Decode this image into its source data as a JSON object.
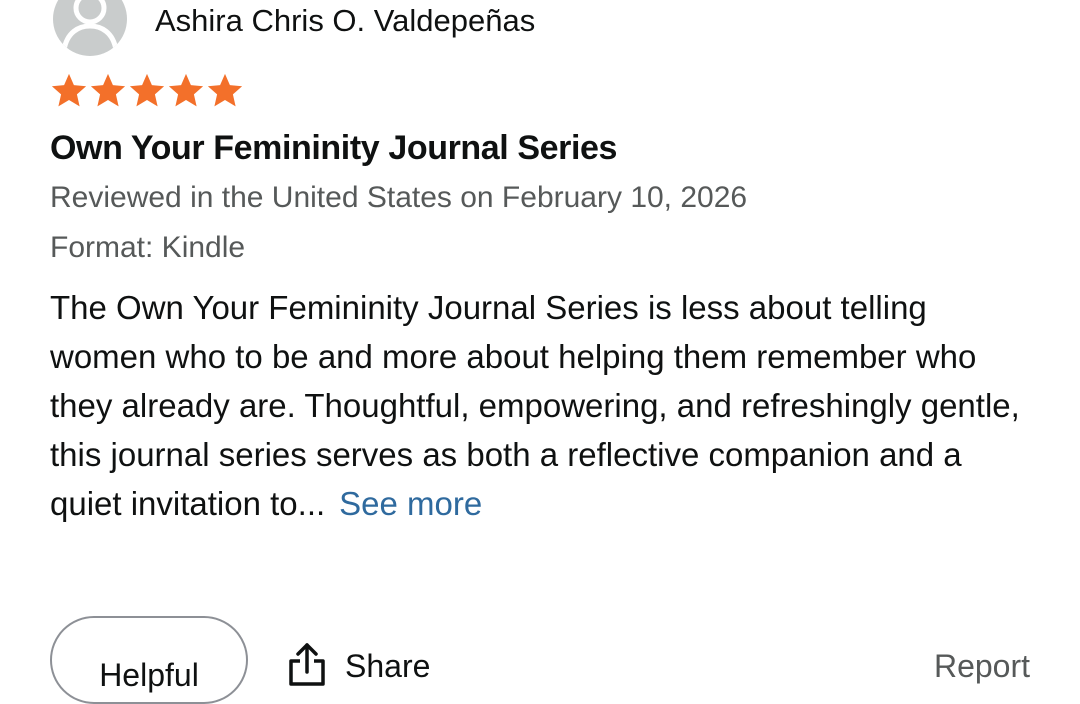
{
  "reviewer": {
    "name": "Ashira Chris O. Valdepeñas",
    "avatar_icon": "person-silhouette-icon"
  },
  "rating": {
    "stars": 5,
    "max": 5,
    "color": "#f3702a",
    "icon": "star-icon"
  },
  "review": {
    "title": "Own Your Femininity Journal Series",
    "reviewed_line": "Reviewed in the United States on February 10, 2026",
    "format_line": "Format: Kindle",
    "body": "The Own Your Femininity Journal Series is less about telling women who to be and more about helping them remember who they already are. Thoughtful, empowering, and refreshingly gentle, this journal series serves as both a reflective companion and a quiet invitation to...",
    "see_more_label": "See more"
  },
  "actions": {
    "helpful_label": "Helpful",
    "share_label": "Share",
    "share_icon": "share-icon",
    "report_label": "Report"
  },
  "colors": {
    "link": "#2f6a9e",
    "secondary_text": "#565959",
    "star": "#f3702a"
  }
}
